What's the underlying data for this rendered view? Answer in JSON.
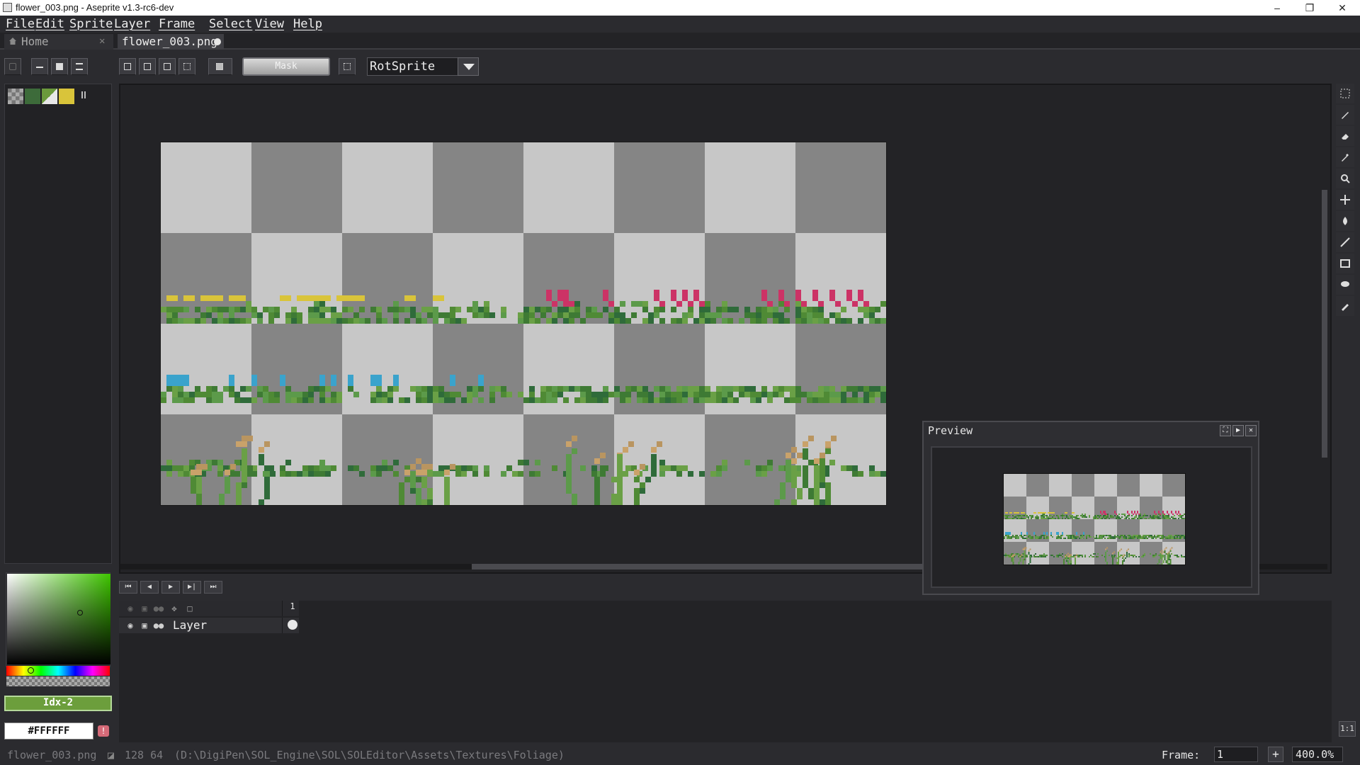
{
  "window": {
    "title": "flower_003.png - Aseprite v1.3-rc6-dev",
    "minimize": "–",
    "maximize": "❐",
    "close": "✕"
  },
  "menu": [
    "File",
    "Edit",
    "Sprite",
    "Layer",
    "Frame",
    "Select",
    "View",
    "Help"
  ],
  "tabs": {
    "home_label": "Home",
    "home_close": "✕",
    "file_label": "flower_003.png"
  },
  "context_bar": {
    "mask_label": "Mask",
    "rotation_algorithm": "RotSprite"
  },
  "palette": {
    "swatch_colors": [
      "#9a9a9a",
      "#3d6b3a",
      "#6b9a3c",
      "#d9c43a"
    ]
  },
  "color": {
    "index_label": "Idx-2",
    "hex_value": "#FFFFFF",
    "warning": "!"
  },
  "colors": {
    "accent_green": "#6c9e3c",
    "yellow_flower": "#d9c43a",
    "pink_flower": "#cc3366",
    "blue_flower": "#3aa3cc"
  },
  "timeline": {
    "buttons": [
      "⏮",
      "◀",
      "▶",
      "▶|",
      "⏭"
    ],
    "frame_number": "1",
    "layer_name": "Layer"
  },
  "preview": {
    "title": "Preview"
  },
  "status": {
    "filename": "flower_003.png",
    "size": "128 64",
    "path": "(D:\\DigiPen\\SOL_Engine\\SOL\\SOLEditor\\Assets\\Textures\\Foliage)",
    "frame_label": "Frame:",
    "frame_value": "1",
    "plus": "+",
    "zoom": "400.0%"
  },
  "corner_button": "1:1"
}
